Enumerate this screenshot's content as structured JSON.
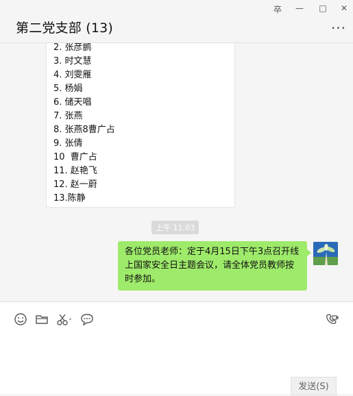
{
  "window": {
    "title": "第二党支部 (13)",
    "controls": {
      "pin": "卒",
      "minimize": "—",
      "maximize": "□",
      "close": "✕"
    },
    "more": "..."
  },
  "chat": {
    "member_list": [
      "2. 张彦鹏",
      "3. 时文慧",
      "4. 刘雯雁",
      "5. 杨娟",
      "6. 储天唱",
      "7. 张燕",
      "8. 张燕8曹广占",
      "9. 张倩",
      "10  曹广占",
      "11. 赵艳飞",
      "12. 赵一蔚",
      "13.陈静"
    ],
    "timestamp": "上午 11:03",
    "outgoing_message": "各位党员老师：定于4月15日下午3点召开线上国家安全日主题会议，请全体党员教师按时参加。"
  },
  "toolbar": {
    "icons": [
      "emoji-icon",
      "folder-icon",
      "scissors-icon",
      "chat-bubble-icon",
      "video-call-icon"
    ]
  },
  "input": {
    "send_label": "发送(S)"
  },
  "colors": {
    "outgoing_bubble": "#9eea6a",
    "background": "#f5f5f5"
  }
}
